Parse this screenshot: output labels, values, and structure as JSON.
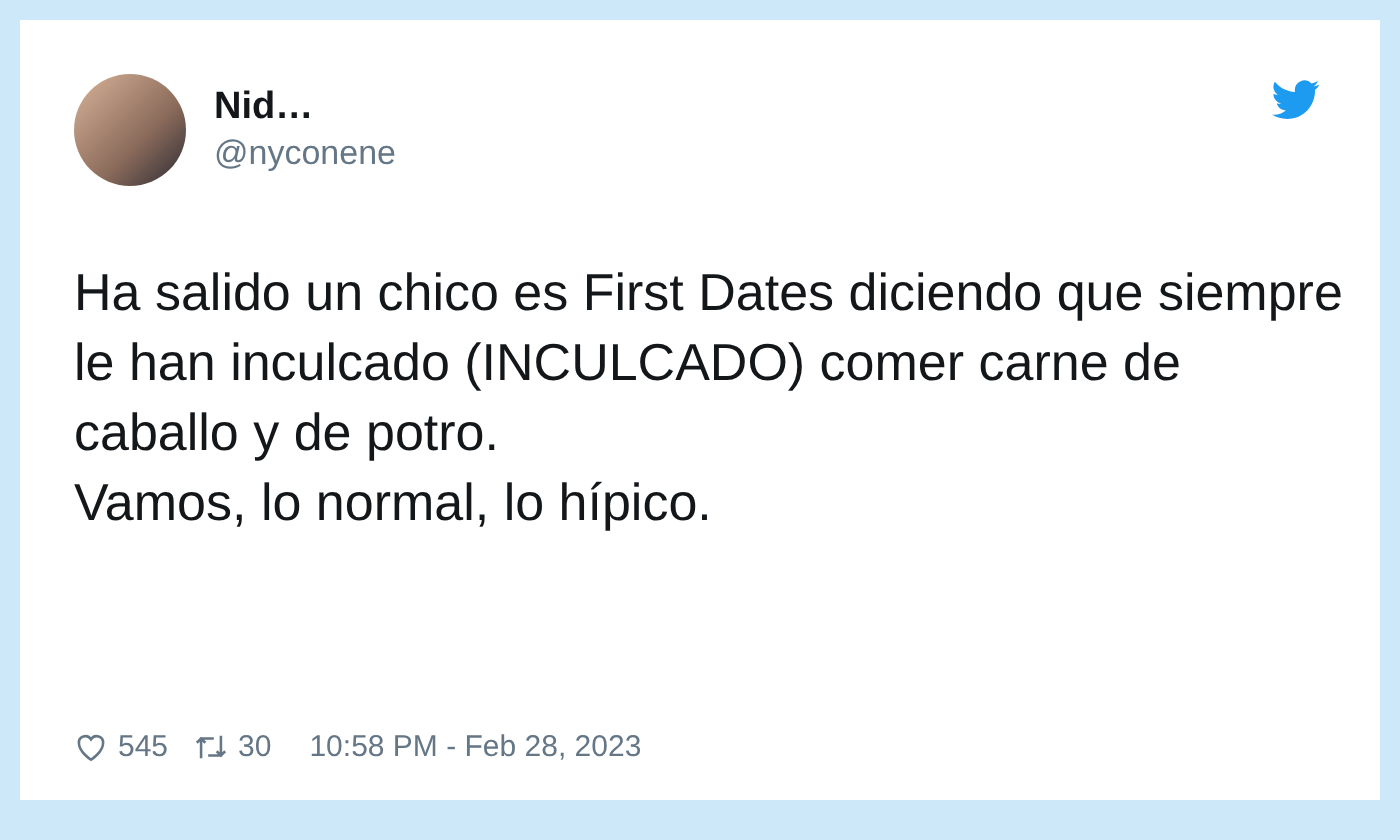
{
  "author": {
    "name": "Nid…",
    "handle": "@nyconene"
  },
  "body": [
    "Ha salido un chico es First Dates diciendo que siempre le han inculcado (INCULCADO) comer carne de caballo y de potro.",
    "Vamos, lo normal, lo hípico."
  ],
  "footer": {
    "likes": "545",
    "retweets": "30",
    "timestamp": "10:58 PM - Feb 28, 2023"
  }
}
